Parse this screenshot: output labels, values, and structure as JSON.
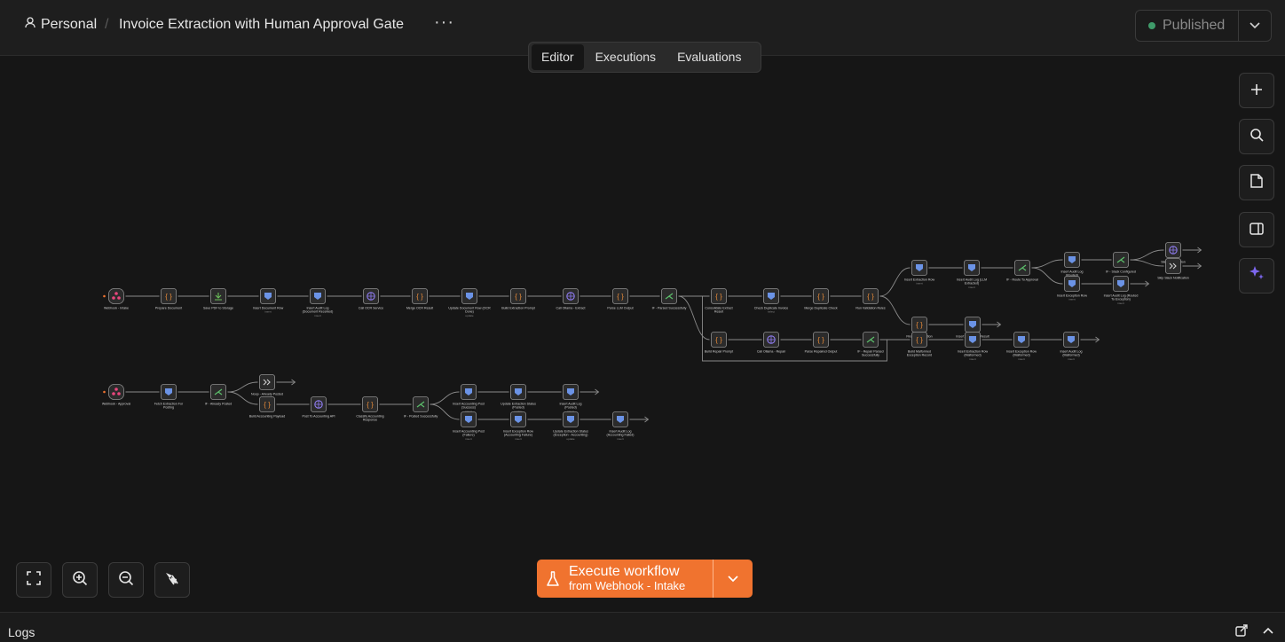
{
  "header": {
    "breadcrumb_project": "Personal",
    "breadcrumb_separator": "/",
    "workflow_title": "Invoice Extraction with Human Approval Gate",
    "more_menu": "···",
    "status_label": "Published"
  },
  "tabs": [
    {
      "label": "Editor",
      "active": true
    },
    {
      "label": "Executions",
      "active": false
    },
    {
      "label": "Evaluations",
      "active": false
    }
  ],
  "execute": {
    "label": "Execute workflow",
    "from_prefix": "from ",
    "from_trigger": "Webhook - Intake"
  },
  "logs": {
    "label": "Logs"
  },
  "colors": {
    "accent_orange": "#f0732f",
    "published_dot": "#3f9b6a",
    "canvas_bg": "#161616",
    "node_bg": "#2b2b2b",
    "edge": "#8a8a8a"
  },
  "workflow": {
    "nodes": [
      {
        "id": "n1",
        "label": "Webhook - Intake",
        "sub": "",
        "icon": "webhook"
      },
      {
        "id": "n2",
        "label": "Prepare Document",
        "sub": "",
        "icon": "code"
      },
      {
        "id": "n3",
        "label": "Save PDF to Storage",
        "sub": "",
        "icon": "storage"
      },
      {
        "id": "n4",
        "label": "Insert Document Row",
        "sub": "insert",
        "icon": "db"
      },
      {
        "id": "n5",
        "label": "Insert Audit Log (Document Received)",
        "sub": "insert",
        "icon": "db"
      },
      {
        "id": "n6",
        "label": "Call OCR Service",
        "sub": "",
        "icon": "http"
      },
      {
        "id": "n7",
        "label": "Merge OCR Result",
        "sub": "",
        "icon": "code"
      },
      {
        "id": "n8",
        "label": "Update Document Row (OCR Done)",
        "sub": "update",
        "icon": "db"
      },
      {
        "id": "n9",
        "label": "Build Extraction Prompt",
        "sub": "",
        "icon": "code"
      },
      {
        "id": "n10",
        "label": "Call Ollama - Extract",
        "sub": "",
        "icon": "http"
      },
      {
        "id": "n11",
        "label": "Parse LLM Output",
        "sub": "",
        "icon": "code"
      },
      {
        "id": "n12",
        "label": "IF - Parsed Successfully",
        "sub": "",
        "icon": "if"
      },
      {
        "id": "n13",
        "label": "Consolidate Extract Result",
        "sub": "",
        "icon": "code"
      },
      {
        "id": "n14",
        "label": "Check Duplicate Invoice",
        "sub": "select",
        "icon": "db"
      },
      {
        "id": "n15",
        "label": "Merge Duplicate Check",
        "sub": "",
        "icon": "code"
      },
      {
        "id": "n16",
        "label": "Run Validation Rules",
        "sub": "",
        "icon": "code"
      },
      {
        "id": "n17",
        "label": "Build Repair Prompt",
        "sub": "",
        "icon": "code"
      },
      {
        "id": "n18",
        "label": "Call Ollama - Repair",
        "sub": "",
        "icon": "http"
      },
      {
        "id": "n19",
        "label": "Parse Repaired Output",
        "sub": "",
        "icon": "code"
      },
      {
        "id": "n20",
        "label": "IF - Repair Parsed Successfully",
        "sub": "",
        "icon": "if"
      },
      {
        "id": "n21",
        "label": "Insert Extraction Row",
        "sub": "insert",
        "icon": "db"
      },
      {
        "id": "n22",
        "label": "Insert Audit Log (LLM Extracted)",
        "sub": "insert",
        "icon": "db"
      },
      {
        "id": "n23",
        "label": "IF - Route To Approval",
        "sub": "",
        "icon": "if"
      },
      {
        "id": "n24",
        "label": "Insert Audit Log (Routed)",
        "sub": "insert",
        "icon": "db"
      },
      {
        "id": "n25",
        "label": "IF - Slack Configured",
        "sub": "",
        "icon": "if"
      },
      {
        "id": "n26",
        "label": "Slack Notification",
        "sub": "",
        "icon": "http"
      },
      {
        "id": "n27",
        "label": "Skip Slack Notification",
        "sub": "",
        "icon": "noop"
      },
      {
        "id": "n28",
        "label": "Insert Exception Row",
        "sub": "insert",
        "icon": "db"
      },
      {
        "id": "n29",
        "label": "Insert Audit Log (Routed To Exception)",
        "sub": "insert",
        "icon": "db"
      },
      {
        "id": "n30",
        "label": "Finalize Extraction Record",
        "sub": "",
        "icon": "code"
      },
      {
        "id": "n31",
        "label": "Insert Extraction Result",
        "sub": "",
        "icon": "db"
      },
      {
        "id": "n32",
        "label": "Build Malformed Exception Record",
        "sub": "",
        "icon": "code"
      },
      {
        "id": "n33",
        "label": "Insert Extraction Row (Malformed)",
        "sub": "insert",
        "icon": "db"
      },
      {
        "id": "n34",
        "label": "Insert Exception Row (Malformed)",
        "sub": "insert",
        "icon": "db"
      },
      {
        "id": "n35",
        "label": "Insert Audit Log (Malformed)",
        "sub": "insert",
        "icon": "db"
      },
      {
        "id": "m1",
        "label": "Webhook - Approval",
        "sub": "",
        "icon": "webhook"
      },
      {
        "id": "m2",
        "label": "Fetch Extraction For Posting",
        "sub": "",
        "icon": "db"
      },
      {
        "id": "m3",
        "label": "IF - Already Posted",
        "sub": "",
        "icon": "if"
      },
      {
        "id": "m4",
        "label": "Noop - Already Posted",
        "sub": "",
        "icon": "noop"
      },
      {
        "id": "m5",
        "label": "Build Accounting Payload",
        "sub": "",
        "icon": "code"
      },
      {
        "id": "m6",
        "label": "Post To Accounting API",
        "sub": "",
        "icon": "http"
      },
      {
        "id": "m7",
        "label": "Classify Accounting Response",
        "sub": "",
        "icon": "code"
      },
      {
        "id": "m8",
        "label": "IF - Posted Successfully",
        "sub": "",
        "icon": "if"
      },
      {
        "id": "m9",
        "label": "Insert Accounting Post (Success)",
        "sub": "insert",
        "icon": "db"
      },
      {
        "id": "m10",
        "label": "Update Extraction Status (Posted)",
        "sub": "update",
        "icon": "db"
      },
      {
        "id": "m11",
        "label": "Insert Audit Log (Posted)",
        "sub": "insert",
        "icon": "db"
      },
      {
        "id": "m12",
        "label": "Insert Accounting Post (Failure)",
        "sub": "insert",
        "icon": "db"
      },
      {
        "id": "m13",
        "label": "Insert Exception Row (Accounting Failure)",
        "sub": "insert",
        "icon": "db"
      },
      {
        "id": "m14",
        "label": "Update Extraction Status (Exception - Accounting)",
        "sub": "update",
        "icon": "db"
      },
      {
        "id": "m15",
        "label": "Insert Audit Log (Accounting Failed)",
        "sub": "insert",
        "icon": "db"
      }
    ]
  }
}
